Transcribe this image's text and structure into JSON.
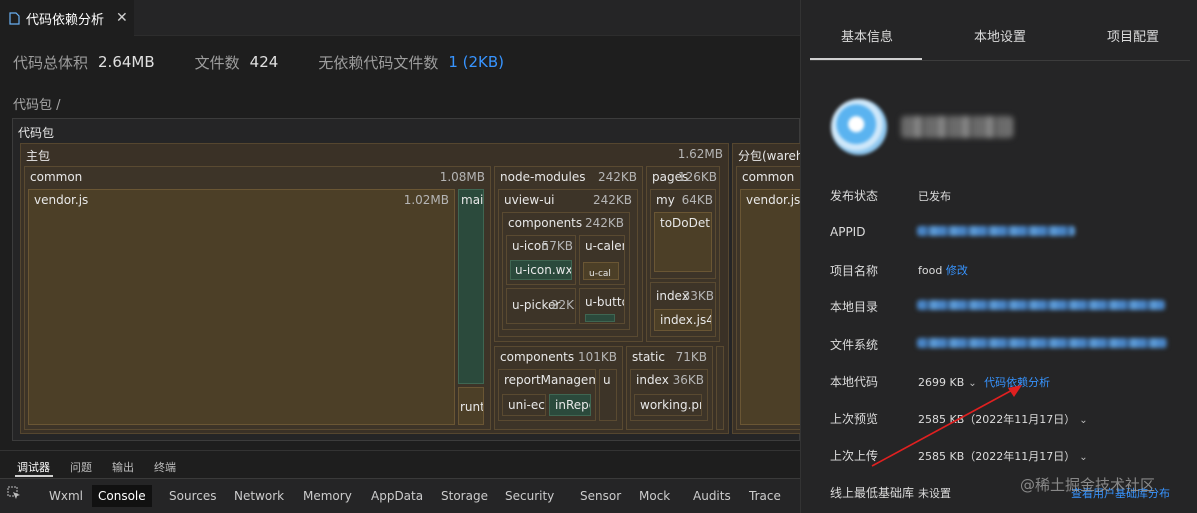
{
  "tab": {
    "title": "代码依赖分析",
    "close": "✕"
  },
  "summary": {
    "total_label": "代码总体积",
    "total_value": "2.64MB",
    "files_label": "文件数",
    "files_value": "424",
    "nodep_label": "无依赖代码文件数",
    "nodep_value": "1 (2KB)"
  },
  "breadcrumb": "代码包 /",
  "treemap": {
    "root": "代码包",
    "main": {
      "name": "主包",
      "size": "1.62MB"
    },
    "sub": {
      "name": "分包(wareho"
    },
    "common": {
      "name": "common",
      "size": "1.08MB"
    },
    "vendor": {
      "name": "vendor.js",
      "size": "1.02MB"
    },
    "mai": "mai",
    "runt": "runt",
    "node_modules": {
      "name": "node-modules",
      "size": "242KB"
    },
    "uview_ui": {
      "name": "uview-ui",
      "size": "242KB"
    },
    "components_nm": {
      "name": "components",
      "size": "242KB"
    },
    "u_icon": {
      "name": "u-icon",
      "size": "57KB"
    },
    "u_icon_wx": "u-icon.wx",
    "u_calen": "u-calen",
    "u_cal_small": "u-cal",
    "u_picker": {
      "name": "u-picker",
      "size": "22K"
    },
    "u_butto": "u-butto",
    "pages": {
      "name": "pages",
      "size": "126KB"
    },
    "my": {
      "name": "my",
      "size": "64KB"
    },
    "todo": "toDoDet",
    "index_pages": {
      "name": "index",
      "size": "33KB"
    },
    "index_js": "index.js4",
    "components": {
      "name": "components",
      "size": "101KB"
    },
    "report": "reportManageme",
    "u_small": "u",
    "uni_ec": "uni-ec-",
    "inrepo": "inRepo",
    "static": {
      "name": "static",
      "size": "71KB"
    },
    "static_index": {
      "name": "index",
      "size": "36KB"
    },
    "working": "working.pn",
    "sub_common": "common",
    "sub_vendor": "vendor.js"
  },
  "panel": {
    "tabs": [
      "基本信息",
      "本地设置",
      "项目配置"
    ],
    "rows": {
      "status_label": "发布状态",
      "status_value": "已发布",
      "appid_label": "APPID",
      "name_label": "项目名称",
      "name_value": "food",
      "name_edit": "修改",
      "dir_label": "本地目录",
      "fs_label": "文件系统",
      "code_label": "本地代码",
      "code_value": "2699 KB",
      "code_link": "代码依赖分析",
      "preview_label": "上次预览",
      "preview_value": "2585 KB（2022年11月17日）",
      "upload_label": "上次上传",
      "upload_value": "2585 KB（2022年11月17日）",
      "minlib_label": "线上最低基础库",
      "minlib_value": "未设置",
      "minlib_link": "查看用户基础库分布"
    },
    "arrow_color": "#e02020"
  },
  "devtools": {
    "top_tabs": [
      "调试器",
      "问题",
      "输出",
      "终端"
    ],
    "tabs": [
      "Wxml",
      "Console",
      "Sources",
      "Network",
      "Memory",
      "AppData",
      "Storage",
      "Security",
      "Sensor",
      "Mock",
      "Audits",
      "Trace"
    ],
    "active": "Console"
  },
  "watermark": "@稀土掘金技术社区"
}
